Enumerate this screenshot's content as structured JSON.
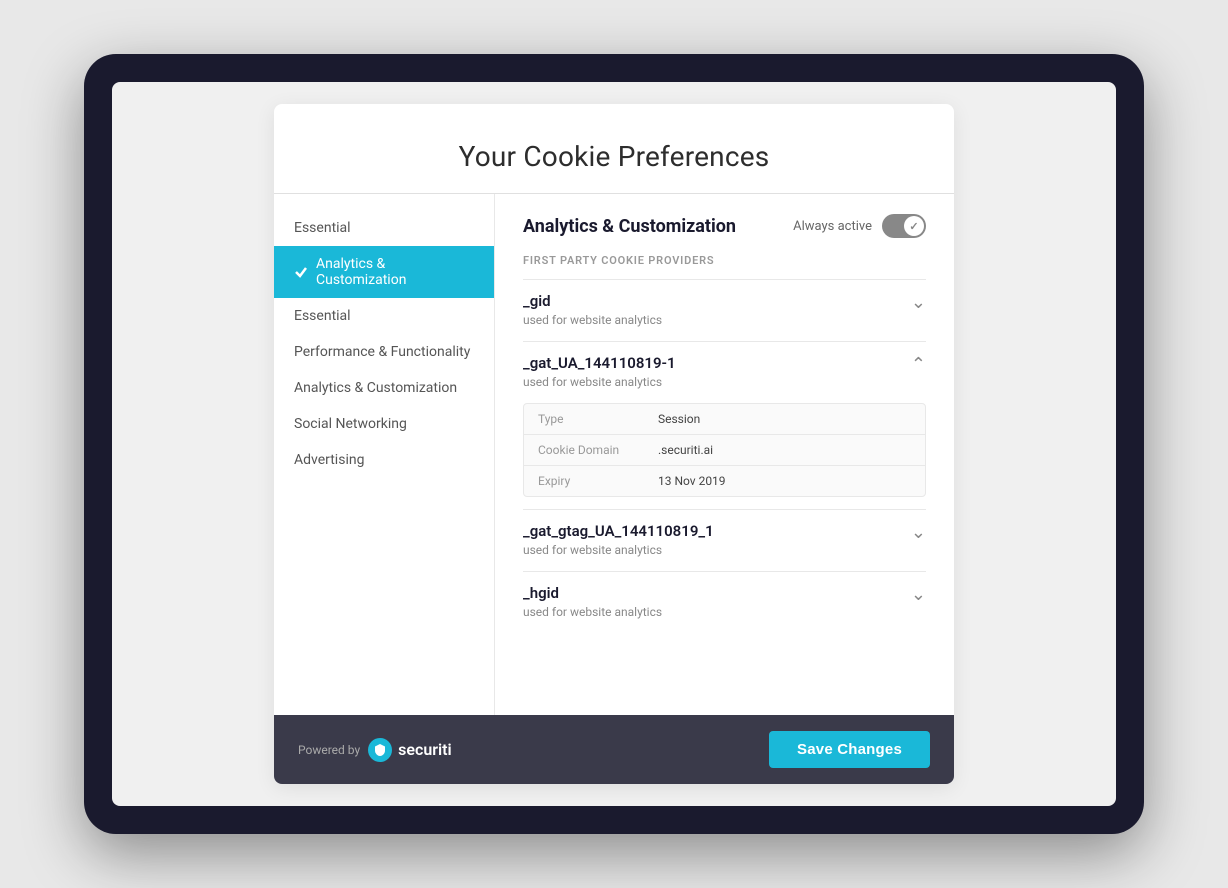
{
  "page": {
    "title": "Your Cookie Preferences"
  },
  "sidebar": {
    "items": [
      {
        "id": "essential-top",
        "label": "Essential",
        "active": false
      },
      {
        "id": "analytics-customization",
        "label": "Analytics & Customization",
        "active": true
      },
      {
        "id": "essential",
        "label": "Essential",
        "active": false
      },
      {
        "id": "performance-functionality",
        "label": "Performance & Functionality",
        "active": false
      },
      {
        "id": "analytics-customization-2",
        "label": "Analytics & Customization",
        "active": false
      },
      {
        "id": "social-networking",
        "label": "Social Networking",
        "active": false
      },
      {
        "id": "advertising",
        "label": "Advertising",
        "active": false
      }
    ]
  },
  "content": {
    "title": "Analytics & Customization",
    "always_active_label": "Always active",
    "section_label": "FIRST PARTY COOKIE PROVIDERS",
    "cookies": [
      {
        "name": "_gid",
        "description": "used for website analytics",
        "expanded": false
      },
      {
        "name": "_gat_UA_144110819-1",
        "description": "used for website analytics",
        "expanded": true,
        "details": [
          {
            "label": "Type",
            "value": "Session"
          },
          {
            "label": "Cookie Domain",
            "value": ".securiti.ai"
          },
          {
            "label": "Expiry",
            "value": "13 Nov 2019"
          }
        ]
      },
      {
        "name": "_gat_gtag_UA_144110819_1",
        "description": "used for website analytics",
        "expanded": false
      },
      {
        "name": "_hgid",
        "description": "used for website analytics",
        "expanded": false
      }
    ]
  },
  "footer": {
    "powered_by_label": "Powered by",
    "brand_name": "securiti",
    "save_button_label": "Save Changes"
  }
}
